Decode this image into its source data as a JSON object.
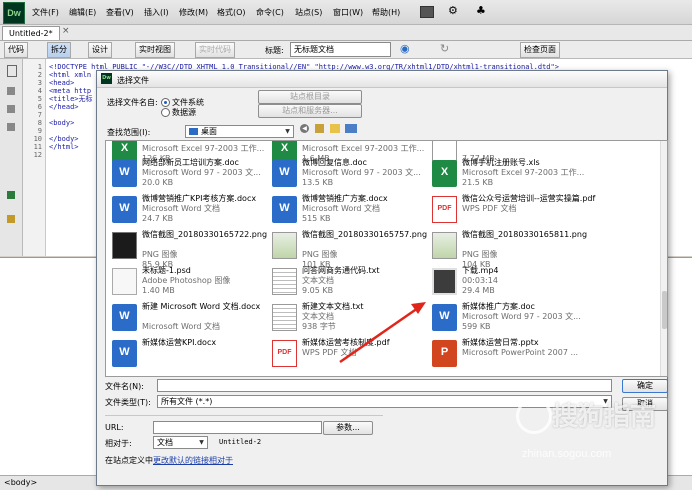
{
  "app": {
    "logo": "Dw",
    "menu": [
      "文件(F)",
      "编辑(E)",
      "查看(V)",
      "插入(I)",
      "修改(M)",
      "格式(O)",
      "命令(C)",
      "站点(S)",
      "窗口(W)",
      "帮助(H)"
    ],
    "doc_tab": "Untitled-2*",
    "toolbar": {
      "code": "代码",
      "split": "拆分",
      "design": "设计",
      "live_view": "实时视图",
      "live_code": "实时代码",
      "title_label": "标题:",
      "title_value": "无标题文档",
      "check_page": "检查页面"
    },
    "line_numbers": [
      "1",
      "2",
      "3",
      "4",
      "5",
      "6",
      "7",
      "8",
      "9",
      "10",
      "11",
      "12"
    ],
    "code_lines": [
      "<!DOCTYPE html PUBLIC \"-//W3C//DTD XHTML 1.0 Transitional//EN\" \"http://www.w3.org/TR/xhtml1/DTD/xhtml1-transitional.dtd\">",
      "<html xmln",
      "<head>",
      "<meta http",
      "<title>无标",
      "</head>",
      "",
      "<body>",
      "",
      "</body>",
      "</html>",
      ""
    ],
    "status": "<body>"
  },
  "dialog": {
    "title": "选择文件",
    "select_name_from": "选择文件名自:",
    "opt_filesystem": "文件系统",
    "opt_datasource": "数据源",
    "btn_site_root": "站点根目录",
    "btn_site_server": "站点和服务器...",
    "lookin_label": "查找范围(I):",
    "lookin_value": "桌面",
    "files": [
      {
        "name": "",
        "type": "Microsoft Excel 97-2003 工作...",
        "size": "126 KB",
        "icon": "excel"
      },
      {
        "name": "",
        "type": "Microsoft Excel 97-2003 工作...",
        "size": "1.6 MB",
        "icon": "excel"
      },
      {
        "name": "",
        "type": "",
        "size": "7.77 MB",
        "icon": "unknown"
      },
      {
        "name": "网络部新员工培训方案.doc",
        "type": "Microsoft Word 97 - 2003 文...",
        "size": "20.0 KB",
        "icon": "word"
      },
      {
        "name": "微博回复信息.doc",
        "type": "Microsoft Word 97 - 2003 文...",
        "size": "13.5 KB",
        "icon": "word"
      },
      {
        "name": "微博手机注册账号.xls",
        "type": "Microsoft Excel 97-2003 工作...",
        "size": "21.5 KB",
        "icon": "excel"
      },
      {
        "name": "微博营销推广KPI考核方案.docx",
        "type": "Microsoft Word 文档",
        "size": "24.7 KB",
        "icon": "word"
      },
      {
        "name": "微博营销推广方案.docx",
        "type": "Microsoft Word 文档",
        "size": "515 KB",
        "icon": "word"
      },
      {
        "name": "微信公众号运营培训--运营实操篇.pdf",
        "type": "WPS PDF 文档",
        "size": "",
        "icon": "pdf"
      },
      {
        "name": "微信截图_20180330165722.png",
        "type": "PNG 图像",
        "size": "85.9 KB",
        "icon": "png-dark"
      },
      {
        "name": "微信截图_20180330165757.png",
        "type": "PNG 图像",
        "size": "101 KB",
        "icon": "png-green"
      },
      {
        "name": "微信截图_20180330165811.png",
        "type": "PNG 图像",
        "size": "104 KB",
        "icon": "png-green"
      },
      {
        "name": "未标题-1.psd",
        "type": "Adobe Photoshop 图像",
        "size": "1.40 MB",
        "icon": "psd"
      },
      {
        "name": "问答网商务通代码.txt",
        "type": "文本文档",
        "size": "9.05 KB",
        "icon": "txt"
      },
      {
        "name": "下载.mp4",
        "type": "00:03:14",
        "size": "29.4 MB",
        "icon": "mp4"
      },
      {
        "name": "新建 Microsoft Word 文档.docx",
        "type": "Microsoft Word 文档",
        "size": "",
        "icon": "word"
      },
      {
        "name": "新建文本文档.txt",
        "type": "文本文档",
        "size": "938 字节",
        "icon": "txt"
      },
      {
        "name": "新媒体推广方案.doc",
        "type": "Microsoft Word 97 - 2003 文...",
        "size": "599 KB",
        "icon": "word"
      },
      {
        "name": "新媒体运营KPI.docx",
        "type": "",
        "size": "",
        "icon": "word"
      },
      {
        "name": "新媒体运营考核制度.pdf",
        "type": "WPS PDF 文档",
        "size": "",
        "icon": "pdf"
      },
      {
        "name": "新媒体运营日常.pptx",
        "type": "Microsoft PowerPoint 2007 ...",
        "size": "",
        "icon": "ppt"
      }
    ],
    "filename_label": "文件名(N):",
    "filename_value": "",
    "filetype_label": "文件类型(T):",
    "filetype_value": "所有文件 (*.*)",
    "ok": "确定",
    "cancel": "取消",
    "url_label": "URL:",
    "url_value": "",
    "browse": "参数...",
    "relative_label": "相对于:",
    "relative_value": "文档",
    "relative_doc": "Untitled-2",
    "footer_prefix": "在站点定义中",
    "footer_link": "更改默认的链接相对于"
  },
  "watermark": {
    "text": "搜狗指南",
    "url": "zhinan.sogou.com"
  },
  "colors": {
    "arrow": "#e0261b",
    "link": "#1b3ea8",
    "ok_border": "#3a78d0"
  }
}
